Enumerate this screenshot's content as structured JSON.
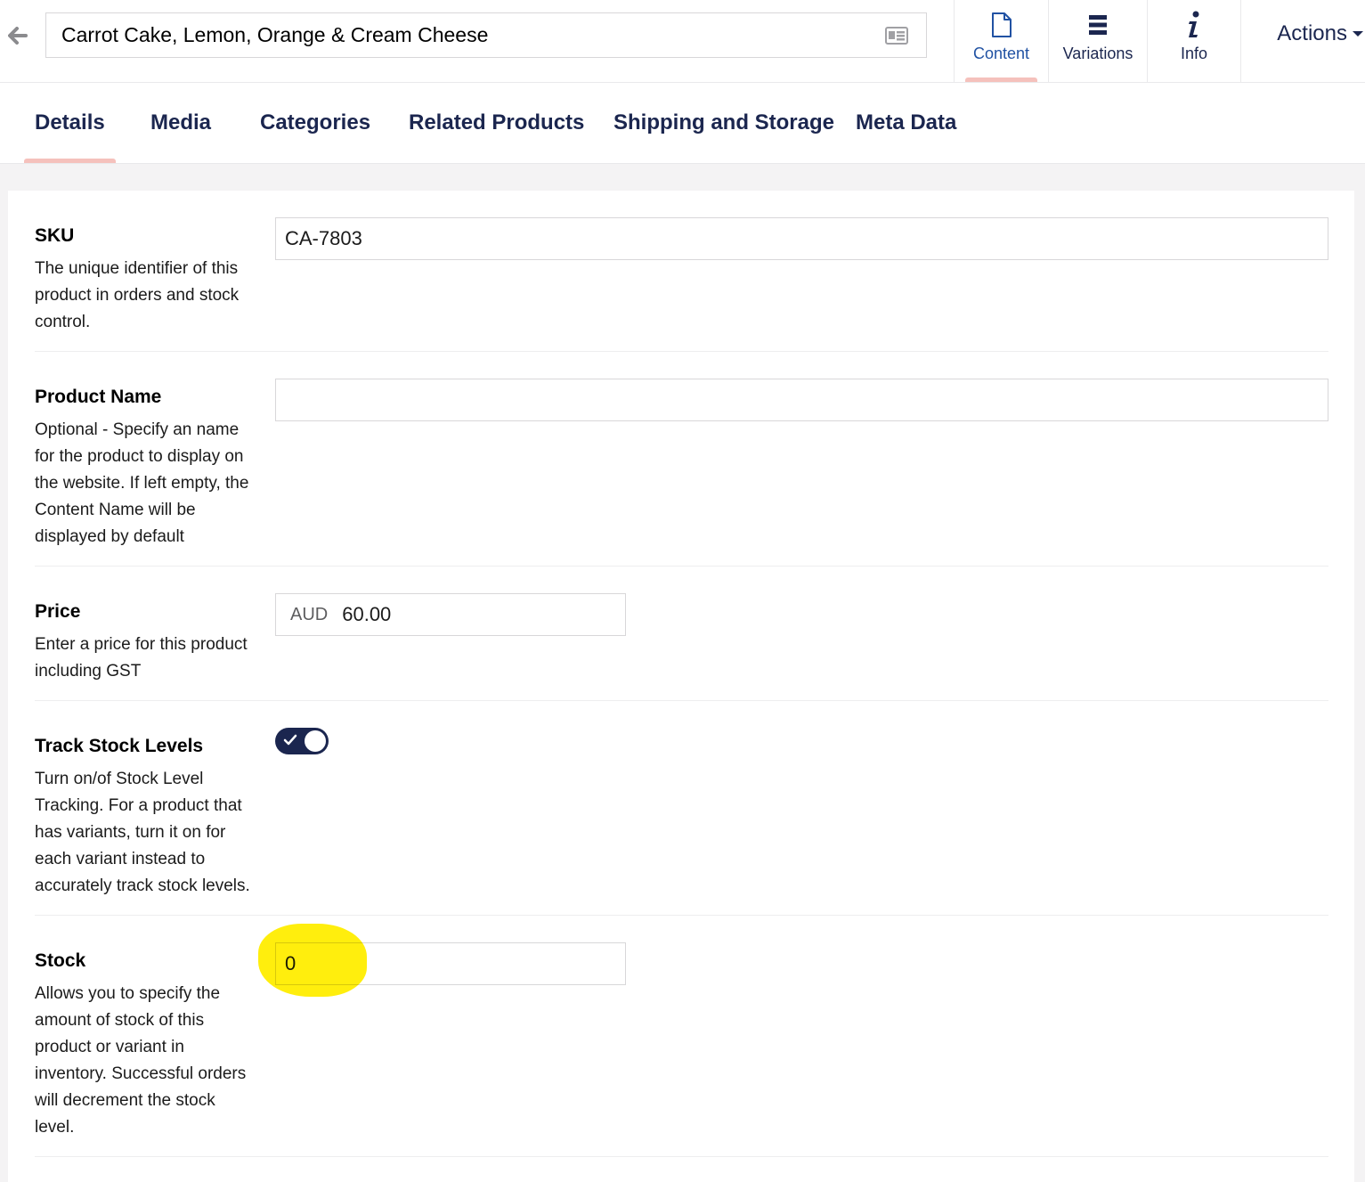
{
  "header": {
    "content_name": "Carrot Cake, Lemon, Orange & Cream Cheese",
    "app_tabs": [
      {
        "label": "Content",
        "icon": "document-icon",
        "active": true
      },
      {
        "label": "Variations",
        "icon": "list-icon",
        "active": false
      },
      {
        "label": "Info",
        "icon": "info-icon",
        "active": false
      }
    ],
    "actions_label": "Actions"
  },
  "subtabs": [
    {
      "label": "Details",
      "active": true
    },
    {
      "label": "Media",
      "active": false
    },
    {
      "label": "Categories",
      "active": false
    },
    {
      "label": "Related Products",
      "active": false
    },
    {
      "label": "Shipping and Storage",
      "active": false
    },
    {
      "label": "Meta Data",
      "active": false
    }
  ],
  "fields": {
    "sku": {
      "label": "SKU",
      "description": "The unique identifier of this product in orders and stock control.",
      "value": "CA-7803"
    },
    "product_name": {
      "label": "Product Name",
      "description": "Optional - Specify an name for the product to display on the website. If left empty, the Content Name will be displayed by default",
      "value": ""
    },
    "price": {
      "label": "Price",
      "description": "Enter a price for this product including GST",
      "currency": "AUD",
      "value": "60.00"
    },
    "track_stock": {
      "label": "Track Stock Levels",
      "description": "Turn on/of Stock Level Tracking. For a product that has variants, turn it on for each variant instead to accurately track stock levels.",
      "enabled": true
    },
    "stock": {
      "label": "Stock",
      "description": "Allows you to specify the amount of stock of this product or variant in inventory. Successful orders will decrement the stock level.",
      "value": "0"
    }
  },
  "colors": {
    "navy": "#1b264f",
    "active_tab_text": "#2152a3",
    "tab_indicator": "#f5c1bc",
    "highlight": "#ffee00"
  }
}
